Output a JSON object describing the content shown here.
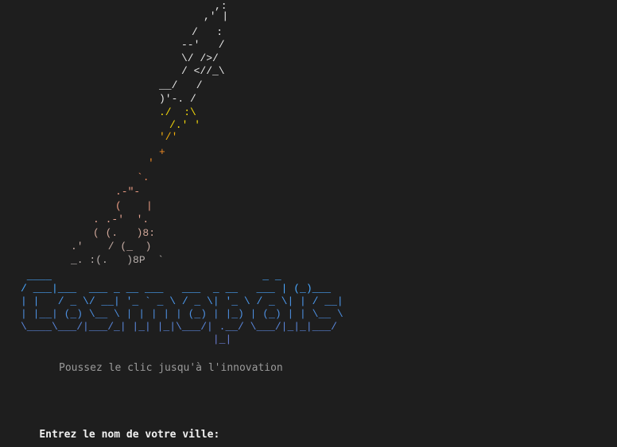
{
  "colors": {
    "background": "#1e1e1e",
    "rocket": "#e8e8e8",
    "flame_yellow": "#f5d90a",
    "flame_orange": "#f08a24",
    "smoke_salmon": "#e89a82",
    "smoke_light": "#d2a89a",
    "smoke_grey": "#b8b0ad",
    "logo_top": "#4aa8ff",
    "logo_mid": "#4d8fe0",
    "logo_bottom": "#6b7fd6",
    "tagline": "#9a9a9a",
    "prompt": "#f2f2f2"
  },
  "rocket_art": {
    "lines": [
      ",:",
      ",' |",
      "/   :",
      "--'   /",
      "\\/ />/",
      "/ <//_\\",
      "__/   /",
      ")'-. /",
      "./  :\\",
      "/.' '",
      "'/'",
      "+",
      "'",
      "`.",
      ".-\"-",
      "(    |",
      ". .-'  '.",
      "( (.   )8:",
      ".'    / (_  )",
      "_. :(.   )8P  `"
    ]
  },
  "logo_art": {
    "lines": [
      " ____                                  _ _",
      "/ ___|___  ___ _ __ ___   ___  _ __   ___ | (_)___",
      "| |   / _ \\/ __| '_ ` _ \\ / _ \\| '_ \\ / _ \\| | / __|",
      "| |__| (_) \\__ \\ | | | | | (_) | |_) | (_) | | \\__ \\",
      "\\____\\___/|___/_| |_| |_|\\___/| .__/ \\___/|_|_|___/",
      "                               |_|"
    ]
  },
  "tagline": "Poussez le clic jusqu'à l'innovation",
  "prompt": {
    "label": "Entrez le nom de votre ville:"
  }
}
